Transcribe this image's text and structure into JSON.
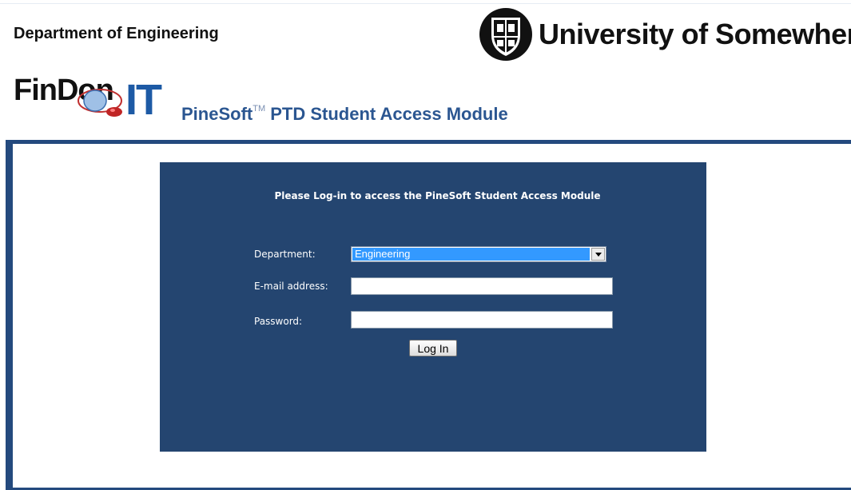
{
  "header": {
    "department": "Department of Engineering",
    "university": "University of Somewhere"
  },
  "brand": {
    "logo_text": "FinDon",
    "logo_it": "IT",
    "module_name_prefix": "PineSoft",
    "trademark": "TM",
    "module_name_suffix": " PTD Student Access Module"
  },
  "login": {
    "heading": "Please Log-in to access the PineSoft Student Access Module",
    "department_label": "Department:",
    "department_selected": "Engineering",
    "email_label": "E-mail address:",
    "email_value": "",
    "password_label": "Password:",
    "password_value": "",
    "submit_label": "Log In"
  },
  "colors": {
    "panel": "#244570",
    "frame": "#244a7e",
    "module_title": "#2b5691",
    "logo_it": "#1d5aa5",
    "selected_option": "#3399ff"
  },
  "icons": [
    "university-crest-icon",
    "mouse-logo-icon",
    "dropdown-arrow-icon"
  ]
}
